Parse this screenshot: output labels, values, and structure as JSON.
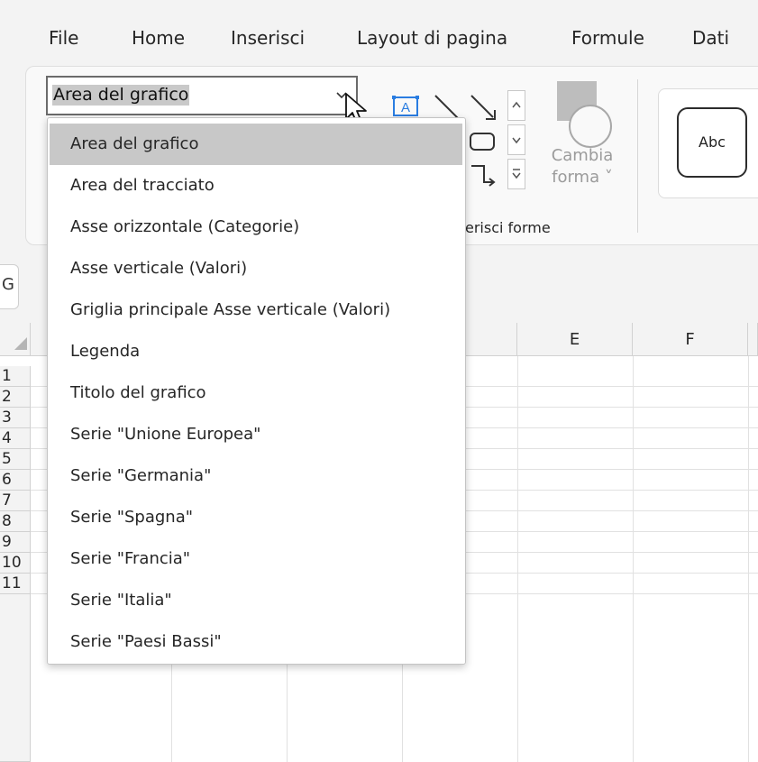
{
  "menu": {
    "tabs": [
      "File",
      "Home",
      "Inserisci",
      "Layout di pagina",
      "Formule",
      "Dati"
    ]
  },
  "ribbon": {
    "selection_box": {
      "value": "Area del grafico"
    },
    "shapes_group_label": "erisci forme",
    "change_shape_label_line1": "Cambia",
    "change_shape_label_line2": "forma ˅",
    "style_sample": "Abc"
  },
  "namebox": {
    "visible_char": "G"
  },
  "grid": {
    "column_headers": [
      "E",
      "F"
    ],
    "row_headers": [
      "1",
      "2",
      "3",
      "4",
      "5",
      "6",
      "7",
      "8",
      "9",
      "10",
      "11"
    ]
  },
  "dropdown": {
    "selected_index": 0,
    "items": [
      "Area del grafico",
      "Area del tracciato",
      "Asse orizzontale (Categorie)",
      "Asse verticale (Valori)",
      "Griglia principale Asse verticale (Valori)",
      "Legenda",
      "Titolo del grafico",
      "Serie \"Unione Europea\"",
      "Serie \"Germania\"",
      "Serie \"Spagna\"",
      "Serie \"Francia\"",
      "Serie \"Italia\"",
      "Serie \"Paesi Bassi\""
    ]
  },
  "colors": {
    "selected_item_bg": "#c8c8c8",
    "icon_accent": "#2a7de1"
  },
  "icons": [
    "chevron-down-icon",
    "mouse-pointer-icon",
    "textbox-shape-icon",
    "line-shape-icon",
    "arrow-line-shape-icon",
    "rounded-rectangle-shape-icon",
    "elbow-connector-shape-icon",
    "scroll-up-icon",
    "scroll-down-icon",
    "more-shapes-icon",
    "change-shape-icon"
  ]
}
